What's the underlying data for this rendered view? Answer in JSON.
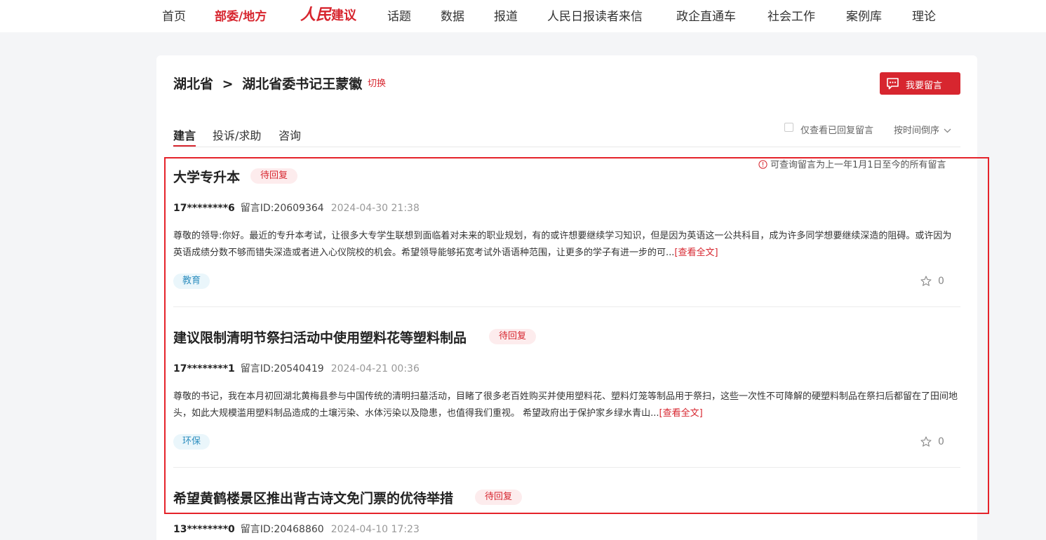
{
  "nav": {
    "items": [
      "首页",
      "部委/地方"
    ],
    "logo": {
      "part1": "人民",
      "part2": "建议"
    },
    "items_right": [
      "话题",
      "数据",
      "报道",
      "人民日报读者来信",
      "政企直通车",
      "社会工作",
      "案例库",
      "理论"
    ],
    "active_color": "#d7262f"
  },
  "breadcrumb": {
    "province": "湖北省",
    "separator": ">",
    "target": "湖北省委书记王蒙徽",
    "switch_label": "切换"
  },
  "leave_message_button": {
    "label": "我要留言",
    "icon": "message-icon"
  },
  "tabs": [
    {
      "label": "建言",
      "active": true
    },
    {
      "label": "投诉/求助",
      "active": false
    },
    {
      "label": "咨询",
      "active": false
    }
  ],
  "filters": {
    "only_replied_label": "仅查看已回复留言",
    "only_replied_checked": false,
    "sort_label": "按时间倒序"
  },
  "notice": "可查询留言为上一年1月1日至今的所有留言",
  "items": [
    {
      "title": "大学专升本",
      "status": "待回复",
      "user": "17********6",
      "message_id": "留言ID:20609364",
      "date": "2024-04-30 21:38",
      "content": "尊敬的领导:你好。最近的专升本考试，让很多大专学生联想到面临着对未来的职业规划，有的或许想要继续学习知识，但是因为英语这一公共科目，成为许多同学想要继续深造的阻碍。或许因为英语成绩分数不够而错失深造或者进入心仪院校的机会。希望领导能够拓宽考试外语语种范围，让更多的学子有进一步的可...",
      "more": "[查看全文]",
      "tag": "教育",
      "favorites": "0"
    },
    {
      "title": "建议限制清明节祭扫活动中使用塑料花等塑料制品",
      "status": "待回复",
      "user": "17********1",
      "message_id": "留言ID:20540419",
      "date": "2024-04-21 00:36",
      "content": "尊敬的书记，我在本月初回湖北黄梅县参与中国传统的清明扫墓活动，目睹了很多老百姓购买并使用塑料花、塑料灯笼等制品用于祭扫，这些一次性不可降解的硬塑料制品在祭扫后都留在了田间地头，如此大规模滥用塑料制品造成的土壤污染、水体污染以及隐患，也值得我们重视。 希望政府出于保护家乡绿水青山...",
      "more": "[查看全文]",
      "tag": "环保",
      "favorites": "0"
    },
    {
      "title": "希望黄鹤楼景区推出背古诗文免门票的优待举措",
      "status": "待回复",
      "user": "13********0",
      "message_id": "留言ID:20468860",
      "date": "2024-04-10 17:23"
    }
  ]
}
